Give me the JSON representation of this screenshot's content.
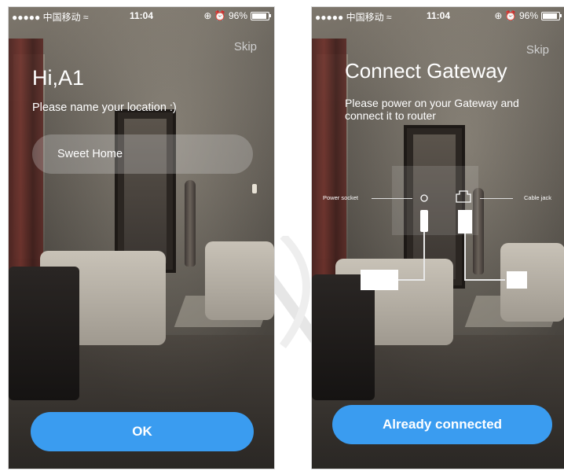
{
  "status_bar": {
    "carrier": "●●●●● 中国移动 ≈",
    "time": "11:04",
    "indicators": "⊕ ⏰ 96%"
  },
  "screen1": {
    "skip": "Skip",
    "greeting": "Hi,A1",
    "prompt": "Please name your location :)",
    "location_value": "Sweet Home",
    "ok_button": "OK"
  },
  "screen2": {
    "skip": "Skip",
    "title": "Connect Gateway",
    "description": "Please power on your Gateway and connect it to router",
    "diagram": {
      "power_socket_label": "Power socket",
      "cable_jack_label": "Cable jack"
    },
    "connected_button": "Already connected"
  },
  "colors": {
    "button": "#3a9cf0",
    "text": "#ffffff",
    "skip": "#cfcfcf"
  },
  "icons": [
    "power-socket-icon",
    "ethernet-port-icon",
    "power-plug-icon",
    "ethernet-plug-icon",
    "battery-icon"
  ]
}
